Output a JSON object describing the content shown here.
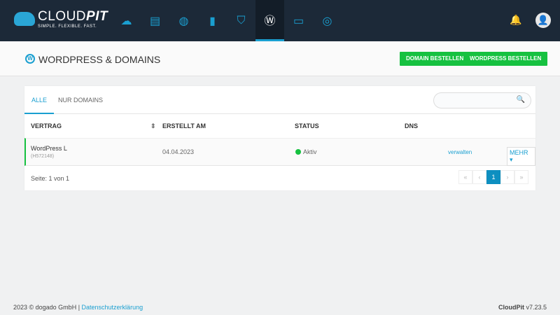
{
  "brand": {
    "name_light": "CLOUD",
    "name_bold": "PIT",
    "tagline": "SIMPLE. FLEXIBLE. FAST."
  },
  "nav": [
    {
      "icon": "cloud-icon",
      "glyph": "☁"
    },
    {
      "icon": "invoice-icon",
      "glyph": "▤"
    },
    {
      "icon": "globe-icon",
      "glyph": "◍"
    },
    {
      "icon": "office-icon",
      "glyph": "▮"
    },
    {
      "icon": "shield-icon",
      "glyph": "⛉"
    },
    {
      "icon": "wordpress-icon",
      "glyph": "Ⓦ"
    },
    {
      "icon": "browser-icon",
      "glyph": "▭"
    },
    {
      "icon": "support-icon",
      "glyph": "◎"
    }
  ],
  "header": {
    "title": "WORDPRESS & DOMAINS",
    "btn_domain": "DOMAIN BESTELLEN",
    "btn_wp": "WORDPRESS BESTELLEN"
  },
  "tabs": [
    "ALLE",
    "NUR DOMAINS"
  ],
  "columns": [
    "VERTRAG",
    "ERSTELLT AM",
    "STATUS",
    "DNS"
  ],
  "rows": [
    {
      "name": "WordPress L",
      "id": "(H572148)",
      "date": "04.04.2023",
      "status": "Aktiv",
      "action": "verwalten",
      "more": "MEHR ▾"
    }
  ],
  "pagination": {
    "info": "Seite: 1 von 1",
    "current": "1"
  },
  "footer": {
    "copy": "2023 © dogado GmbH | ",
    "privacy": "Datenschutzerklärung",
    "version_name": "CloudPit",
    "version": " v7.23.5"
  },
  "colors": {
    "accent": "#1a9fd0",
    "green": "#16c140",
    "topbar": "#1c2938"
  }
}
